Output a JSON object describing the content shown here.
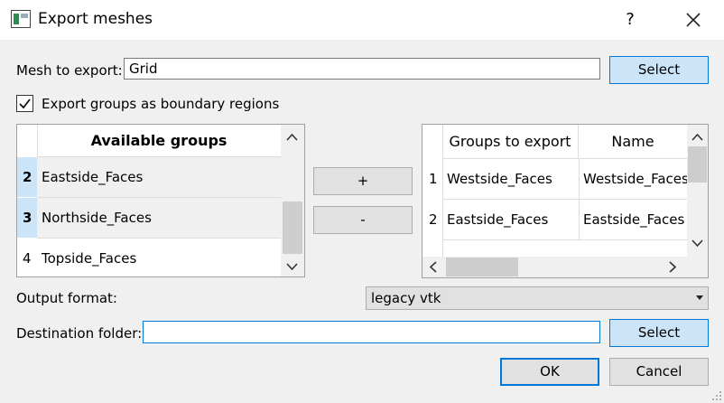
{
  "window": {
    "title": "Export meshes",
    "help": "?"
  },
  "mesh": {
    "label": "Mesh to export:",
    "value": "Grid",
    "select_label": "Select"
  },
  "export_groups": {
    "label": "Export groups as boundary regions",
    "checked": true
  },
  "available": {
    "header": "Available groups",
    "rows": [
      {
        "num": "2",
        "name": "Eastside_Faces",
        "selected": true
      },
      {
        "num": "3",
        "name": "Northside_Faces",
        "selected": true
      },
      {
        "num": "4",
        "name": "Topside_Faces",
        "selected": false
      }
    ]
  },
  "buttons": {
    "add": "+",
    "remove": "-"
  },
  "export_table": {
    "headers": [
      "Groups to export",
      "Name"
    ],
    "rows": [
      {
        "num": "1",
        "group": "Westside_Faces",
        "name": "Westside_Faces"
      },
      {
        "num": "2",
        "group": "Eastside_Faces",
        "name": "Eastside_Faces"
      }
    ]
  },
  "output": {
    "label": "Output format:",
    "value": "legacy vtk"
  },
  "destination": {
    "label": "Destination folder:",
    "value": "",
    "select_label": "Select"
  },
  "dialog": {
    "ok": "OK",
    "cancel": "Cancel"
  }
}
